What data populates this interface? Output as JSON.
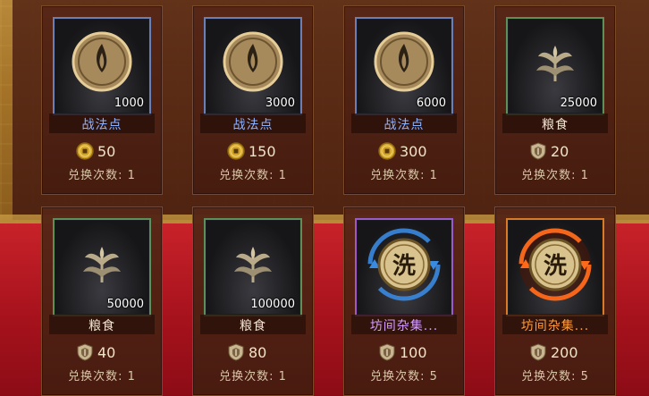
{
  "cards": [
    {
      "name": "战法点",
      "qty": "1000",
      "cost": "50",
      "currency": "copper-coin-icon",
      "limit_label": "兑换次数:",
      "limit": "1"
    },
    {
      "name": "战法点",
      "qty": "3000",
      "cost": "150",
      "currency": "copper-coin-icon",
      "limit_label": "兑换次数:",
      "limit": "1"
    },
    {
      "name": "战法点",
      "qty": "6000",
      "cost": "300",
      "currency": "copper-coin-icon",
      "limit_label": "兑换次数:",
      "limit": "1"
    },
    {
      "name": "粮食",
      "qty": "25000",
      "cost": "20",
      "currency": "shield-token-icon",
      "limit_label": "兑换次数:",
      "limit": "1"
    },
    {
      "name": "粮食",
      "qty": "50000",
      "cost": "40",
      "currency": "shield-token-icon",
      "limit_label": "兑换次数:",
      "limit": "1"
    },
    {
      "name": "粮食",
      "qty": "100000",
      "cost": "80",
      "currency": "shield-token-icon",
      "limit_label": "兑换次数:",
      "limit": "1"
    },
    {
      "name": "坊间杂集...",
      "qty": "",
      "cost": "100",
      "currency": "shield-token-icon",
      "limit_label": "兑换次数:",
      "limit": "5",
      "icon_char": "洗"
    },
    {
      "name": "坊间杂集...",
      "qty": "",
      "cost": "200",
      "currency": "shield-token-icon",
      "limit_label": "兑换次数:",
      "limit": "5",
      "icon_char": "洗"
    }
  ],
  "colors": {
    "blue_name": "#8fb4ff",
    "purple_name": "#d69cff",
    "orange_name": "#ff9b3c",
    "coin": "#d4a62a"
  }
}
